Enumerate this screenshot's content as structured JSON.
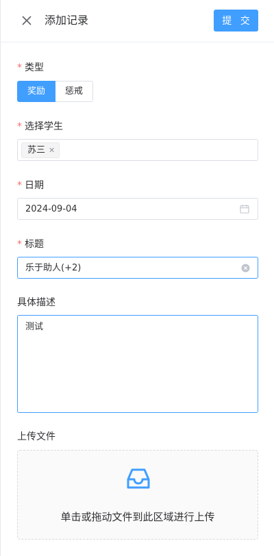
{
  "header": {
    "title": "添加记录",
    "submit_label": "提 交"
  },
  "form": {
    "type": {
      "label": "类型",
      "options": [
        "奖励",
        "惩戒"
      ],
      "selected": "奖励"
    },
    "student": {
      "label": "选择学生",
      "selected_tag": "苏三"
    },
    "date": {
      "label": "日期",
      "value": "2024-09-04"
    },
    "title": {
      "label": "标题",
      "value": "乐于助人(+2)"
    },
    "description": {
      "label": "具体描述",
      "value": "测试"
    },
    "upload": {
      "label": "上传文件",
      "hint": "单击或拖动文件到此区域进行上传"
    }
  },
  "colors": {
    "primary": "#409eff",
    "required": "#f56c6c"
  }
}
